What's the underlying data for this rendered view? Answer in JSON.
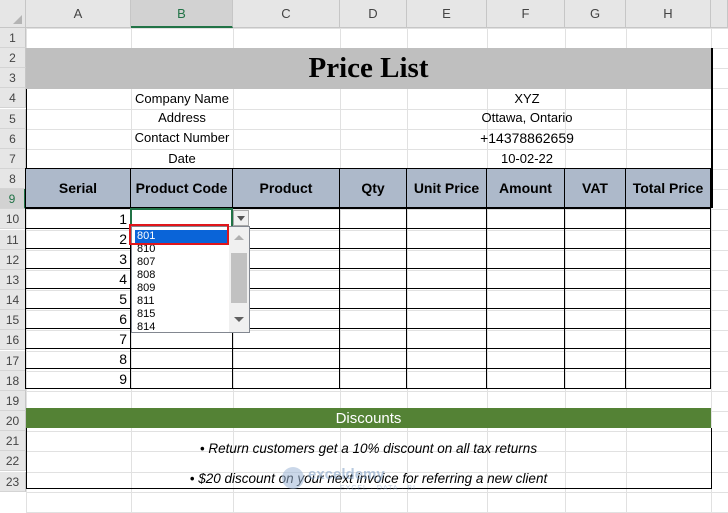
{
  "columns": [
    "A",
    "B",
    "C",
    "D",
    "E",
    "F",
    "G",
    "H"
  ],
  "rows": [
    "1",
    "2",
    "3",
    "4",
    "5",
    "6",
    "7",
    "8",
    "9",
    "10",
    "11",
    "12",
    "13",
    "14",
    "15",
    "16",
    "17",
    "18",
    "19",
    "20",
    "21",
    "22",
    "23"
  ],
  "title": "Price List",
  "info": {
    "labels": [
      "Company Name",
      "Address",
      "Contact Number",
      "Date"
    ],
    "values": [
      "XYZ",
      "Ottawa, Ontario",
      "+14378862659",
      "10-02-22"
    ]
  },
  "table": {
    "headers": [
      "Serial",
      "Product Code",
      "Product",
      "Qty",
      "Unit Price",
      "Amount",
      "VAT",
      "Total Price"
    ],
    "serials": [
      "1",
      "2",
      "3",
      "4",
      "5",
      "6",
      "7",
      "8",
      "9"
    ]
  },
  "dropdown": {
    "options": [
      "801",
      "810",
      "807",
      "808",
      "809",
      "811",
      "815",
      "814"
    ],
    "selected": "801"
  },
  "discounts": {
    "title": "Discounts",
    "notes": [
      "• Return customers get a 10% discount on all tax returns",
      "• $20 discount on your next invoice for referring a new client"
    ]
  },
  "watermark": {
    "brand": "exceldemy",
    "tagline": "EXCEL · DATA · BI"
  },
  "colors": {
    "title_fill": "#bfbfbf",
    "header_fill": "#adb9ca",
    "discount_fill": "#548235",
    "selection": "#217346",
    "highlight": "#0a64d8",
    "callout": "#e0161b"
  }
}
